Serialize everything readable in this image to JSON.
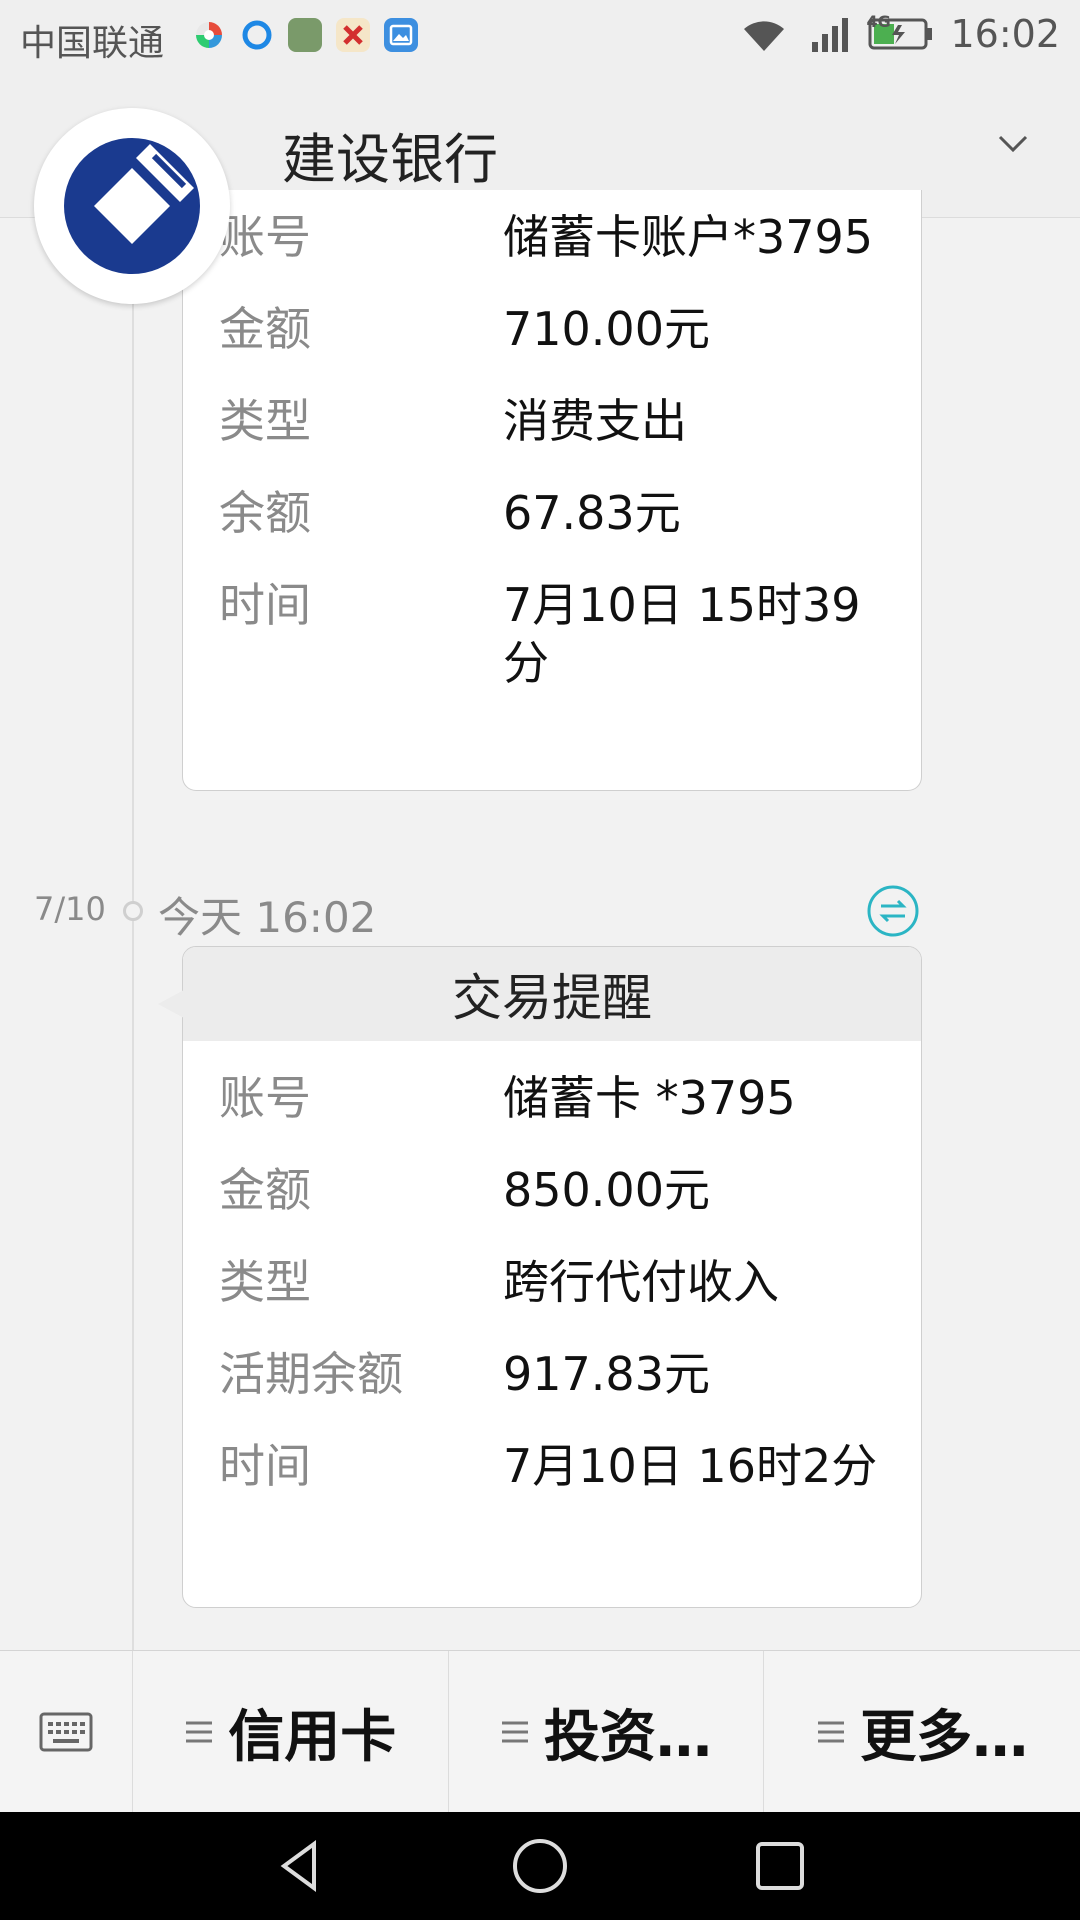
{
  "status_bar": {
    "carrier": "中国联通",
    "network": "4G",
    "time": "16:02",
    "icons": [
      "app-icon-1",
      "app-icon-2",
      "app-icon-3",
      "app-icon-4",
      "app-icon-5"
    ]
  },
  "header": {
    "title": "建设银行",
    "menu_icon": "chevron-down-icon"
  },
  "avatar": {
    "icon": "ccb-logo-icon",
    "brand_color": "#1a3a8f"
  },
  "messages": [
    {
      "title": "",
      "rows": [
        {
          "label": "账号",
          "value": "储蓄卡账户*3795"
        },
        {
          "label": "金额",
          "value": "710.00元"
        },
        {
          "label": "类型",
          "value": "消费支出"
        },
        {
          "label": "余额",
          "value": "67.83元"
        },
        {
          "label": "时间",
          "value": "7月10日 15时39分"
        }
      ]
    },
    {
      "date": "7/10",
      "time": "今天 16:02",
      "title": "交易提醒",
      "rows": [
        {
          "label": "账号",
          "value": "储蓄卡 *3795"
        },
        {
          "label": "金额",
          "value": "850.00元"
        },
        {
          "label": "类型",
          "value": "跨行代付收入"
        },
        {
          "label": "活期余额",
          "value": "917.83元"
        },
        {
          "label": "时间",
          "value": "7月10日 16时2分"
        }
      ]
    }
  ],
  "bottom_menu": {
    "keyboard_icon": "keyboard-icon",
    "items": [
      {
        "label": "信用卡"
      },
      {
        "label": "投资…"
      },
      {
        "label": "更多…"
      }
    ]
  },
  "nav_bar": {
    "icons": [
      "back-icon",
      "home-icon",
      "recents-icon"
    ]
  },
  "colors": {
    "accent": "#2bb5c4",
    "background": "#f2f2f2",
    "card": "#ffffff"
  }
}
